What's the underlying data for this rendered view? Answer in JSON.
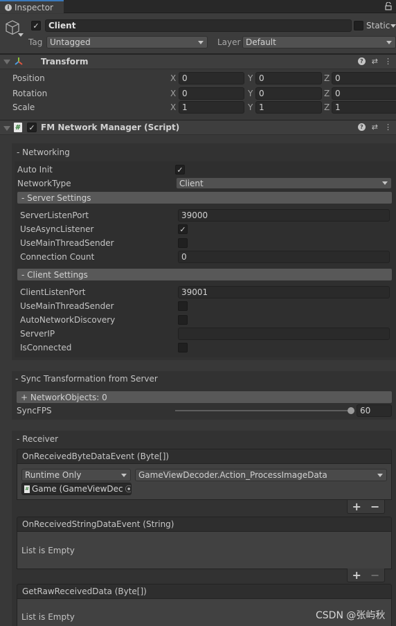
{
  "window": {
    "tab_label": "Inspector",
    "tab_icon": "info-icon",
    "lock_icon": "lock-icon"
  },
  "gameobject": {
    "active": true,
    "name": "Client",
    "static_label": "Static",
    "static_checked": false,
    "tag_label": "Tag",
    "tag_value": "Untagged",
    "layer_label": "Layer",
    "layer_value": "Default"
  },
  "transform": {
    "title": "Transform",
    "rows": [
      {
        "label": "Position",
        "x": "0",
        "y": "0",
        "z": "0"
      },
      {
        "label": "Rotation",
        "x": "0",
        "y": "0",
        "z": "0"
      },
      {
        "label": "Scale",
        "x": "1",
        "y": "1",
        "z": "1"
      }
    ],
    "axes": {
      "x": "X",
      "y": "Y",
      "z": "Z"
    }
  },
  "script": {
    "title": "FM Network Manager (Script)",
    "enabled": true,
    "networking": {
      "header": "- Networking",
      "auto_init_label": "Auto Init",
      "auto_init": true,
      "network_type_label": "NetworkType",
      "network_type_value": "Client",
      "server_settings": {
        "header": "- Server Settings",
        "server_listen_port_label": "ServerListenPort",
        "server_listen_port": "39000",
        "use_async_listener_label": "UseAsyncListener",
        "use_async_listener": true,
        "use_main_thread_sender_label": "UseMainThreadSender",
        "use_main_thread_sender": false,
        "connection_count_label": "Connection Count",
        "connection_count": "0"
      },
      "client_settings": {
        "header": "- Client Settings",
        "client_listen_port_label": "ClientListenPort",
        "client_listen_port": "39001",
        "use_main_thread_sender_label": "UseMainThreadSender",
        "use_main_thread_sender": false,
        "auto_network_discovery_label": "AutoNetworkDiscovery",
        "auto_network_discovery": false,
        "server_ip_label": "ServerIP",
        "server_ip": "",
        "is_connected_label": "IsConnected",
        "is_connected": false
      }
    },
    "sync": {
      "header": "- Sync Transformation from Server",
      "network_objects_label": "+ NetworkObjects: 0",
      "sync_fps_label": "SyncFPS",
      "sync_fps_value": "60",
      "sync_fps_fraction": 1.0
    },
    "receiver": {
      "header": "- Receiver",
      "events": [
        {
          "title": "OnReceivedByteDataEvent (Byte[])",
          "runtime_mode": "Runtime Only",
          "function": "GameViewDecoder.Action_ProcessImageData",
          "target_object": "Game (GameViewDec",
          "add_label": "+",
          "remove_label": "−"
        },
        {
          "title": "OnReceivedStringDataEvent (String)",
          "empty_label": "List is Empty",
          "add_label": "+",
          "remove_label": "−"
        },
        {
          "title": "GetRawReceivedData (Byte[])",
          "empty_label": "List is Empty"
        }
      ]
    }
  },
  "watermark": "CSDN @张屿秋"
}
